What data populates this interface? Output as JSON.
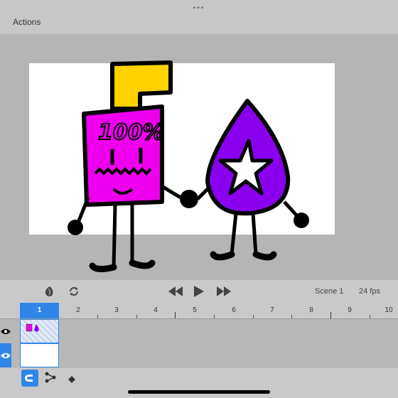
{
  "topbar": {
    "handle": "•••",
    "actions_label": "Actions"
  },
  "controls": {
    "scene_label": "Scene 1",
    "fps_label": "24 fps",
    "icons": [
      "onion-skin-icon",
      "loop-icon",
      "rewind-icon",
      "play-icon",
      "fast-forward-icon"
    ]
  },
  "timeline": {
    "current_frame": "1",
    "frames": [
      "2",
      "3",
      "4",
      "5",
      "6",
      "7",
      "8",
      "9",
      "10"
    ],
    "layers": [
      "layer-1",
      "layer-2"
    ]
  },
  "bottombar": {
    "icons": [
      "magnet-icon",
      "path-icon",
      "keyframe-icon"
    ]
  },
  "colors": {
    "accent": "#2f86e8",
    "juice_box": "#ee00ee",
    "straw": "#ffd200",
    "drop": "#8a00ee"
  }
}
